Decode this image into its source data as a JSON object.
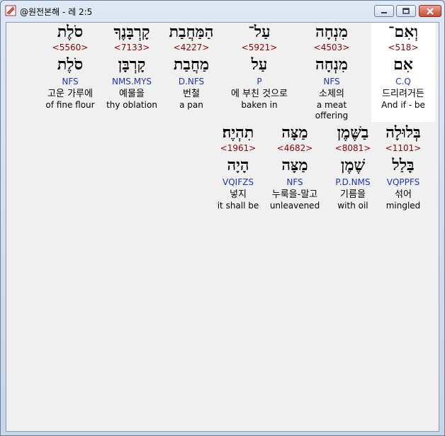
{
  "window": {
    "title": "@원전본해 - 레 2:5"
  },
  "verse": {
    "row1": [
      {
        "heb": "וְאִם־",
        "strong": "<518>",
        "lemma": "אִם",
        "morph": "C.Q",
        "kor": "드리려거든",
        "eng": "And if - be",
        "selected": true
      },
      {
        "heb": "מִנְחָה",
        "strong": "<4503>",
        "lemma": "מִנְחָה",
        "morph": "NFS",
        "kor": "소제의",
        "eng": "a meat offering"
      },
      {
        "heb": "עַל־",
        "strong": "<5921>",
        "lemma": "עַל",
        "morph": "P",
        "kor": "에 부친 것으로",
        "eng": "baken in"
      },
      {
        "heb": "הַמַּחֲבַת",
        "strong": "<4227>",
        "lemma": "מַחֲבַת",
        "morph": "D.NFS",
        "kor": "번철",
        "eng": "a pan"
      },
      {
        "heb": "קָרְבָּנֶךָ",
        "strong": "<7133>",
        "lemma": "קָרְבָּן",
        "morph": "NMS.MYS",
        "kor": "예물을",
        "eng": "thy oblation"
      },
      {
        "heb": "סֹלֶת",
        "strong": "<5560>",
        "lemma": "סֹלֶת",
        "morph": "NFS",
        "kor": "고운 가루에",
        "eng": "of fine flour"
      }
    ],
    "row2": [
      {
        "heb": "בְּלוּלָה",
        "strong": "<1101>",
        "lemma": "בָּלַל",
        "morph": "VQPPFS",
        "kor": "섞어",
        "eng": "mingled"
      },
      {
        "heb": "בַשֶּׁמֶן",
        "strong": "<8081>",
        "lemma": "שֶׁמֶן",
        "morph": "P.D.NMS",
        "kor": "기름을",
        "eng": "with oil"
      },
      {
        "heb": "מַצָּה",
        "strong": "<4682>",
        "lemma": "מַצָּה",
        "morph": "NFS",
        "kor": "누룩을-말고",
        "eng": "unleavened"
      },
      {
        "heb": "תִהְיֶה׃",
        "strong": "<1961>",
        "lemma": "הָיָה",
        "morph": "VQIFZS",
        "kor": "넣지",
        "eng": "it shall be"
      }
    ]
  }
}
